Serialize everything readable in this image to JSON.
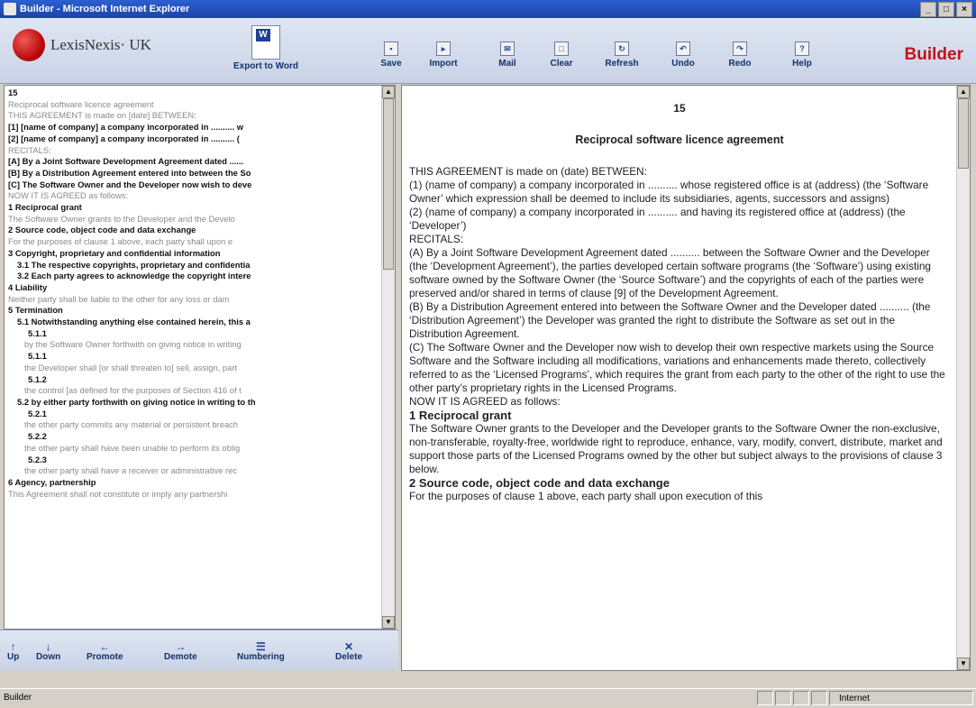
{
  "window": {
    "title": "Builder - Microsoft Internet Explorer",
    "controls": [
      "_",
      "□",
      "×"
    ]
  },
  "toolbar": {
    "logo_text": "LexisNexis· UK",
    "export_label": "Export to Word",
    "buttons": [
      {
        "label": "Save",
        "icon": "▪"
      },
      {
        "label": "Import",
        "icon": "▸"
      },
      {
        "label": "Mail",
        "icon": "✉"
      },
      {
        "label": "Clear",
        "icon": "□"
      },
      {
        "label": "Refresh",
        "icon": "↻"
      },
      {
        "label": "Undo",
        "icon": "↶"
      },
      {
        "label": "Redo",
        "icon": "↷"
      },
      {
        "label": "Help",
        "icon": "?"
      }
    ],
    "brand": "Builder"
  },
  "outline": [
    "15",
    "Reciprocal software licence agreement",
    "THIS AGREEMENT is made on [date] BETWEEN:",
    "[1] [name of company] a company incorporated in .......... w",
    "[2] [name of company] a company incorporated in .......... (",
    "RECITALS:",
    "[A] By a Joint Software Development Agreement dated ......",
    "[B] By a Distribution Agreement entered into between the So",
    "[C] The Software Owner and the Developer now wish to deve",
    "NOW IT IS AGREED as follows:",
    "1 Reciprocal grant",
    "The Software Owner grants to the Developer and the Develo",
    "2 Source code, object code and data exchange",
    "For the purposes of clause 1 above, each party shall upon e",
    "3 Copyright, proprietary and confidential information",
    "3.1 The respective copyrights, proprietary and confidentia",
    "3.2 Each party agrees to acknowledge the copyright intere",
    "4 Liability",
    "Neither party shall be liable to the other for any loss or dam",
    "5 Termination",
    "5.1 Notwithstanding anything else contained herein, this a",
    "5.1.1",
    "by the Software Owner forthwith on giving notice in writing",
    "5.1.1",
    "the Developer shall [or shall threaten to] sell, assign, part",
    "5.1.2",
    "the control [as defined for the purposes of Section 416 of t",
    "5.2 by either party forthwith on giving notice in writing to th",
    "5.2.1",
    "the other party commits any material or persistent breach",
    "5.2.2",
    "the other party shall have been unable to perform its oblig",
    "5.2.3",
    "the other party shall have a receiver or administrative rec",
    "6 Agency, partnership",
    "This Agreement shall not constitute or imply any partnershi"
  ],
  "bottom_buttons": [
    {
      "label": "Up",
      "icon": "↑"
    },
    {
      "label": "Down",
      "icon": "↓"
    },
    {
      "label": "Promote",
      "icon": "←"
    },
    {
      "label": "Demote",
      "icon": "→"
    },
    {
      "label": "Numbering",
      "icon": "☰"
    },
    {
      "label": "Delete",
      "icon": "✕"
    }
  ],
  "document": {
    "number": "15",
    "title": "Reciprocal software licence agreement",
    "paragraphs": [
      "THIS AGREEMENT is made on (date) BETWEEN:",
      "(1) (name of company) a company incorporated in .......... whose registered office is at (address) (the ‘Software Owner’ which expression shall be deemed to include its subsidiaries, agents, successors and assigns)",
      "(2) (name of company) a company incorporated in .......... and having its registered office at (address) (the ‘Developer’)",
      "RECITALS:",
      "(A) By a Joint Software Development Agreement dated .......... between the Software Owner and the Developer (the ‘Development Agreement’), the parties developed certain software programs (the ‘Software’) using existing software owned by the Software Owner (the ‘Source Software’) and the copyrights of each of the parties were preserved and/or shared in terms of clause [9] of the Development Agreement.",
      "(B) By a Distribution Agreement entered into between the Software Owner and the Developer dated .......... (the ‘Distribution Agreement’) the Developer was granted the right to distribute the Software as set out in the Distribution Agreement.",
      "(C) The Software Owner and the Developer now wish to develop their own respective markets using the Source Software and the Software including all modifications, variations and enhancements made thereto, collectively referred to as the ‘Licensed Programs’, which requires the grant from each party to the other of the right to use the other party’s proprietary rights in the Licensed Programs.",
      "NOW IT IS AGREED as follows:"
    ],
    "heading1": "1 Reciprocal grant",
    "clause1": "The Software Owner grants to the Developer and the Developer grants to the Software Owner the non-exclusive, non-transferable, royalty-free, worldwide right to reproduce, enhance, vary, modify, convert, distribute, market and support those parts of the Licensed Programs owned by the other but subject always to the provisions of clause 3 below.",
    "heading2": "2 Source code, object code and data exchange",
    "clause2": "For the purposes of clause 1 above, each party shall upon execution of this"
  },
  "status": {
    "left": "Builder",
    "zone": "Internet"
  }
}
